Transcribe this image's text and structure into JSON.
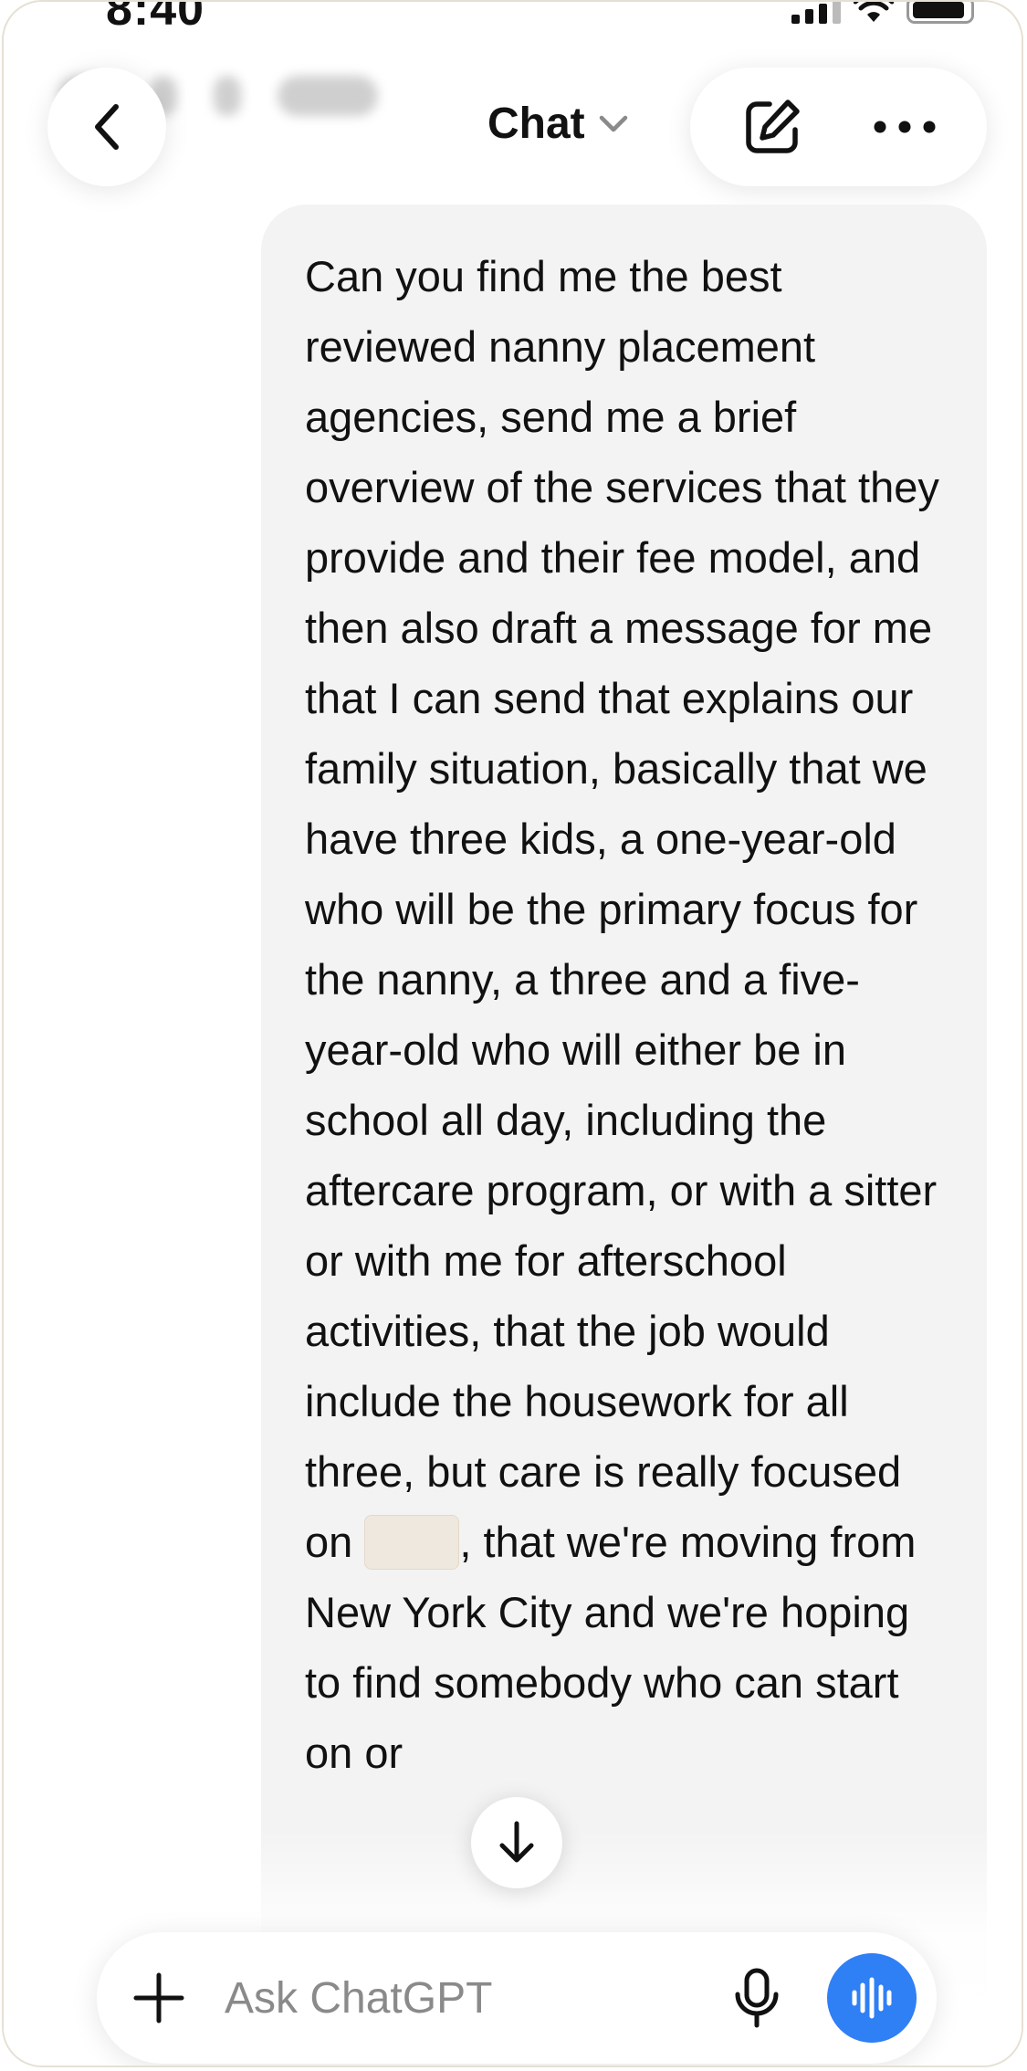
{
  "status_bar": {
    "time": "8:40"
  },
  "header": {
    "title": "Chat",
    "icons": {
      "back": "chevron-left-icon",
      "title_chevron": "chevron-down-icon",
      "new_chat": "edit-icon",
      "more": "more-horizontal-icon"
    }
  },
  "message": {
    "before_redaction": "Can you find me the best reviewed nanny placement agencies, send me a brief overview of the services that they provide and their fee model, and then also draft a message for me that I can send that explains our family situation, basically that we have three kids, a one-year-old who will be the primary focus for the nanny, a three and a five-year-old who will either be in school all day, including the aftercare program, or with a sitter or with me for afterschool activities, that the job would include the housework for all three, but care is really focused on ",
    "after_redaction": ", that we're moving from New York City and we're hoping to find somebody who can start on or"
  },
  "composer": {
    "placeholder": "Ask ChatGPT",
    "icons": {
      "add": "plus-icon",
      "dictate": "microphone-icon",
      "voice_mode": "voice-waveform-icon",
      "scroll": "arrow-down-icon"
    },
    "voice_button_color": "#2f7ff5"
  }
}
